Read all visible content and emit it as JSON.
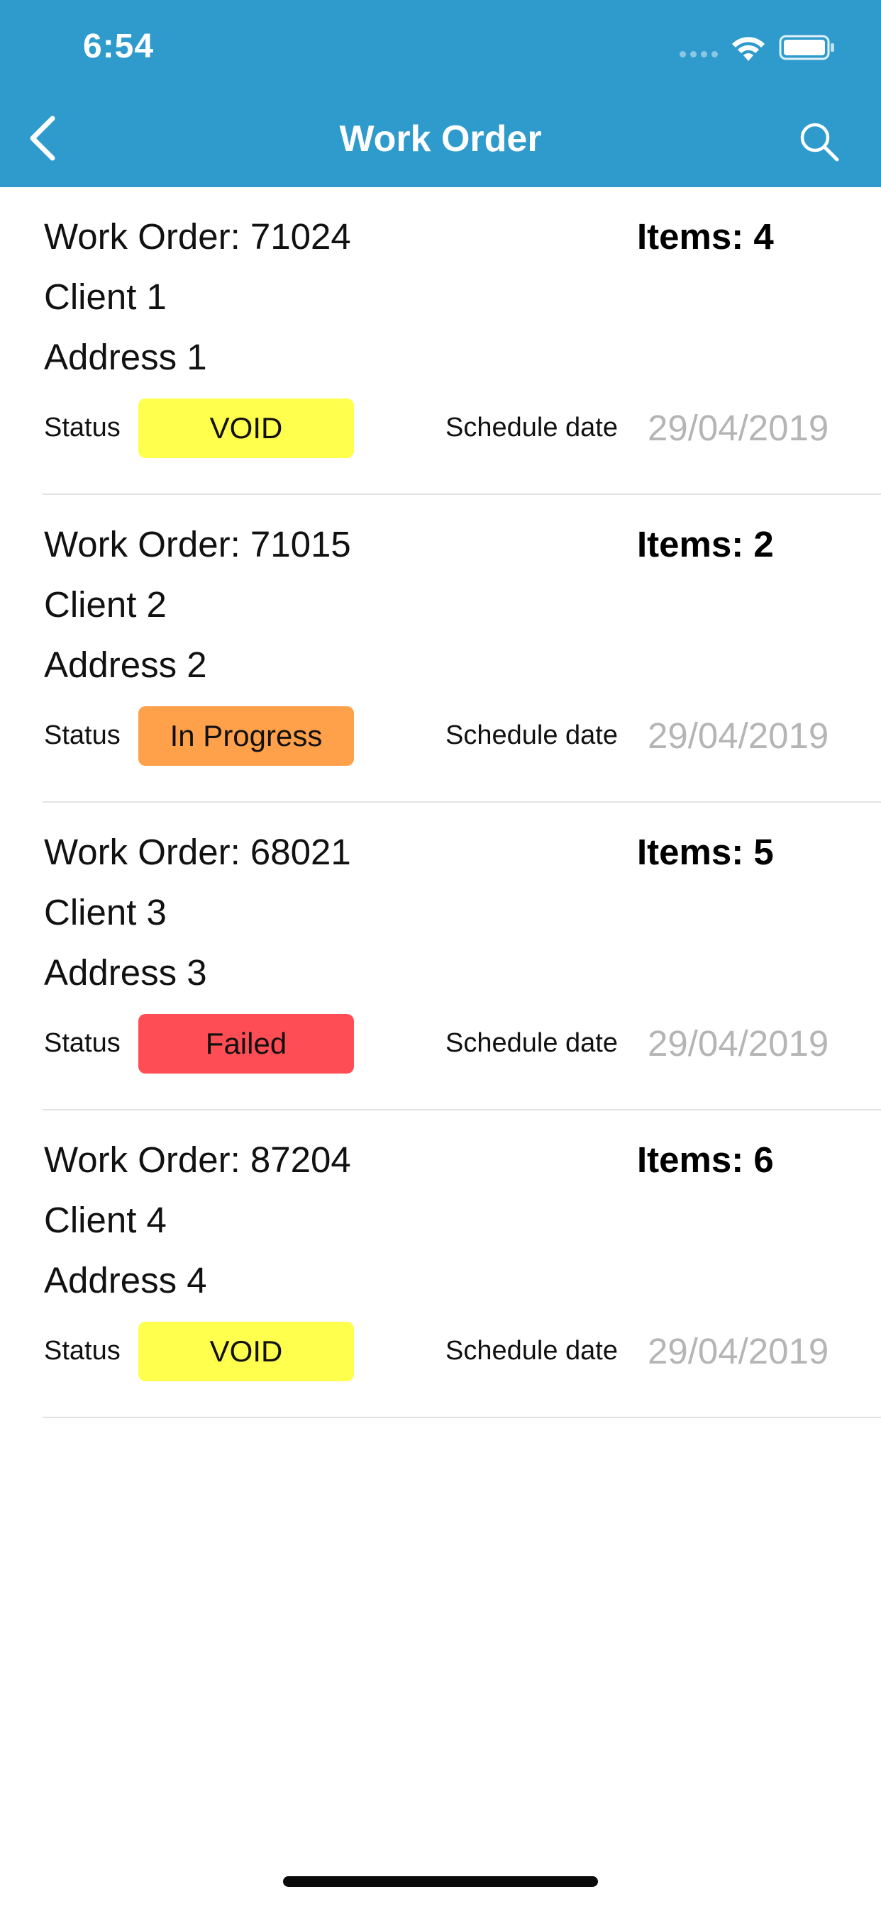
{
  "status_bar": {
    "time": "6:54"
  },
  "nav": {
    "title": "Work Order",
    "back_icon": "chevron-left-icon",
    "search_icon": "search-icon"
  },
  "colors": {
    "header": "#2f9bcd",
    "void": "#ffff4d",
    "in_progress": "#ffa04a",
    "failed": "#ff4d55",
    "date_text": "#b5b5b5"
  },
  "work_orders": [
    {
      "title": "Work Order: 71024",
      "items": "Items: 4",
      "client": "Client 1",
      "address": "Address 1",
      "status_label": "Status",
      "status": "VOID",
      "status_color": "#ffff4d",
      "schedule_label": "Schedule date",
      "schedule_date": "29/04/2019"
    },
    {
      "title": "Work Order: 71015",
      "items": "Items: 2",
      "client": "Client 2",
      "address": "Address 2",
      "status_label": "Status",
      "status": "In Progress",
      "status_color": "#ffa04a",
      "schedule_label": "Schedule date",
      "schedule_date": "29/04/2019"
    },
    {
      "title": "Work Order: 68021",
      "items": "Items: 5",
      "client": "Client 3",
      "address": "Address 3",
      "status_label": "Status",
      "status": "Failed",
      "status_color": "#ff4d55",
      "schedule_label": "Schedule date",
      "schedule_date": "29/04/2019"
    },
    {
      "title": "Work Order: 87204",
      "items": "Items: 6",
      "client": "Client 4",
      "address": "Address 4",
      "status_label": "Status",
      "status": "VOID",
      "status_color": "#ffff4d",
      "schedule_label": "Schedule date",
      "schedule_date": "29/04/2019"
    }
  ]
}
